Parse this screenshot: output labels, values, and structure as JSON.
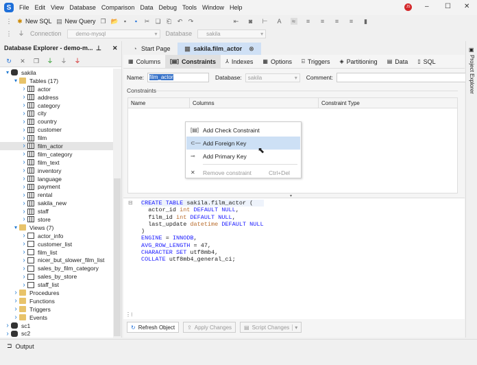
{
  "menu": [
    "File",
    "Edit",
    "View",
    "Database",
    "Comparison",
    "Data",
    "Debug",
    "Tools",
    "Window",
    "Help"
  ],
  "user_badge": "JS",
  "toolbar": {
    "new_sql": "New SQL",
    "new_query": "New Query"
  },
  "connbar": {
    "connection_label": "Connection",
    "connection_value": "demo-mysql",
    "database_label": "Database",
    "database_value": "sakila"
  },
  "explorer": {
    "title": "Database Explorer - demo-m...",
    "tree": [
      {
        "label": "sakila",
        "level": 0,
        "type": "db",
        "open": true
      },
      {
        "label": "Tables (17)",
        "level": 1,
        "type": "folder",
        "open": true
      },
      {
        "label": "actor",
        "level": 2,
        "type": "table"
      },
      {
        "label": "address",
        "level": 2,
        "type": "table"
      },
      {
        "label": "category",
        "level": 2,
        "type": "table"
      },
      {
        "label": "city",
        "level": 2,
        "type": "table"
      },
      {
        "label": "country",
        "level": 2,
        "type": "table"
      },
      {
        "label": "customer",
        "level": 2,
        "type": "table"
      },
      {
        "label": "film",
        "level": 2,
        "type": "table"
      },
      {
        "label": "film_actor",
        "level": 2,
        "type": "table",
        "selected": true
      },
      {
        "label": "film_category",
        "level": 2,
        "type": "table"
      },
      {
        "label": "film_text",
        "level": 2,
        "type": "table"
      },
      {
        "label": "inventory",
        "level": 2,
        "type": "table"
      },
      {
        "label": "language",
        "level": 2,
        "type": "table"
      },
      {
        "label": "payment",
        "level": 2,
        "type": "table"
      },
      {
        "label": "rental",
        "level": 2,
        "type": "table"
      },
      {
        "label": "sakila_new",
        "level": 2,
        "type": "table"
      },
      {
        "label": "staff",
        "level": 2,
        "type": "table"
      },
      {
        "label": "store",
        "level": 2,
        "type": "table"
      },
      {
        "label": "Views (7)",
        "level": 1,
        "type": "folder",
        "open": true
      },
      {
        "label": "actor_info",
        "level": 2,
        "type": "view"
      },
      {
        "label": "customer_list",
        "level": 2,
        "type": "view"
      },
      {
        "label": "film_list",
        "level": 2,
        "type": "view"
      },
      {
        "label": "nicer_but_slower_film_list",
        "level": 2,
        "type": "view"
      },
      {
        "label": "sales_by_film_category",
        "level": 2,
        "type": "view"
      },
      {
        "label": "sales_by_store",
        "level": 2,
        "type": "view"
      },
      {
        "label": "staff_list",
        "level": 2,
        "type": "view"
      },
      {
        "label": "Procedures",
        "level": 1,
        "type": "folder"
      },
      {
        "label": "Functions",
        "level": 1,
        "type": "folder"
      },
      {
        "label": "Triggers",
        "level": 1,
        "type": "folder"
      },
      {
        "label": "Events",
        "level": 1,
        "type": "folder"
      },
      {
        "label": "sc1",
        "level": 0,
        "type": "db"
      },
      {
        "label": "sc2",
        "level": 0,
        "type": "db"
      }
    ]
  },
  "tabs": [
    {
      "label": "Start Page"
    },
    {
      "label": "sakila.film_actor",
      "active": true
    }
  ],
  "subtabs": [
    "Columns",
    "Constraints",
    "Indexes",
    "Options",
    "Triggers",
    "Partitioning",
    "Data",
    "SQL"
  ],
  "form": {
    "name_label": "Name:",
    "name_value": "film_actor",
    "database_label": "Database:",
    "database_value": "sakila",
    "comment_label": "Comment:",
    "comment_value": ""
  },
  "constraints": {
    "section": "Constraints",
    "columns": [
      "Name",
      "Columns",
      "Constraint Type"
    ]
  },
  "context_menu": [
    {
      "label": "Add Check Constraint",
      "icon": "check-constraint-icon"
    },
    {
      "label": "Add Foreign Key",
      "icon": "foreign-key-icon",
      "highlighted": true
    },
    {
      "label": "Add Primary Key",
      "icon": "primary-key-icon"
    },
    {
      "label": "Remove constraint",
      "shortcut": "Ctrl+Del",
      "icon": "remove-icon",
      "disabled": true
    }
  ],
  "sql": [
    [
      [
        "kw",
        "CREATE TABLE "
      ],
      [
        "",
        "sakila.film_actor ("
      ]
    ],
    [
      [
        "",
        "  actor_id "
      ],
      [
        "ty",
        "int"
      ],
      [
        "kw",
        " DEFAULT NULL"
      ],
      [
        "",
        ","
      ]
    ],
    [
      [
        "",
        "  film_id "
      ],
      [
        "ty",
        "int"
      ],
      [
        "kw",
        " DEFAULT NULL"
      ],
      [
        "",
        ","
      ]
    ],
    [
      [
        "",
        "  last_update "
      ],
      [
        "ty",
        "datetime"
      ],
      [
        "kw",
        " DEFAULT NULL"
      ]
    ],
    [
      [
        "",
        ")"
      ]
    ],
    [
      [
        "kw",
        "ENGINE"
      ],
      [
        "",
        " = "
      ],
      [
        "kw",
        "INNODB"
      ],
      [
        "",
        ","
      ]
    ],
    [
      [
        "kw",
        "AVG_ROW_LENGTH"
      ],
      [
        "",
        " = 47,"
      ]
    ],
    [
      [
        "kw",
        "CHARACTER SET"
      ],
      [
        "",
        " utf8mb4,"
      ]
    ],
    [
      [
        "kw",
        "COLLATE"
      ],
      [
        "",
        " utf8mb4_general_ci;"
      ]
    ]
  ],
  "buttons": {
    "refresh": "Refresh Object",
    "apply": "Apply Changes",
    "script": "Script Changes"
  },
  "right_panel": "Project Explorer",
  "output": "Output"
}
